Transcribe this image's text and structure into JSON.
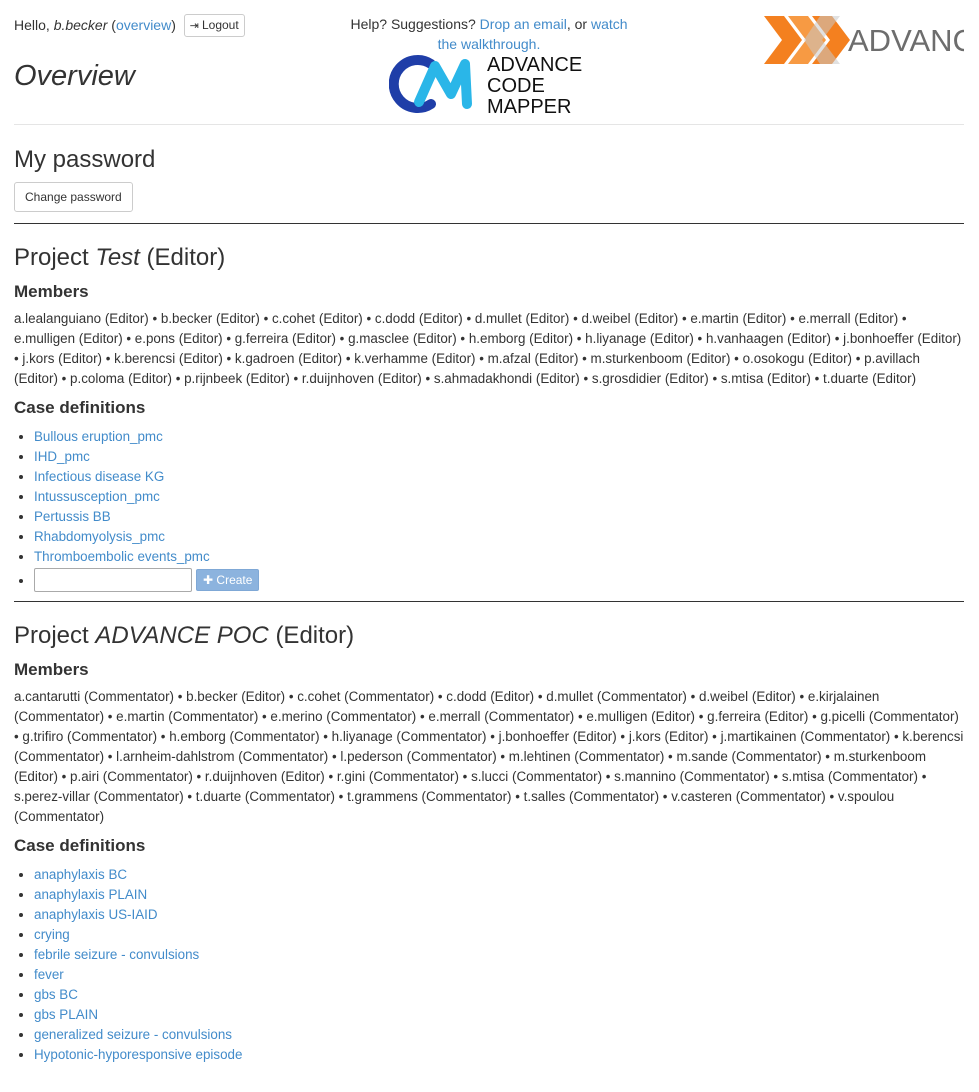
{
  "header": {
    "greeting": "Hello,",
    "username": "b.becker",
    "overview_link": "overview",
    "logout_label": "Logout",
    "page_title": "Overview",
    "help_prefix": "Help? Suggestions?",
    "help_email_link": "Drop an email",
    "help_middle": ", or",
    "help_walkthrough_link": "watch the walkthrough.",
    "cm_logo_text": [
      "ADVANCE",
      "CODE",
      "MAPPER"
    ],
    "advance_logo_text": "ADVANCE",
    "brand_colors": {
      "orange": "#f4801f",
      "blue": "#1f3ea8",
      "cyan": "#2ab6e8"
    }
  },
  "password": {
    "heading": "My password",
    "change_label": "Change password"
  },
  "projects": [
    {
      "heading_prefix": "Project",
      "name": "Test",
      "role": "(Editor)",
      "members_heading": "Members",
      "members_text": "a.lealanguiano (Editor) • b.becker (Editor) • c.cohet (Editor) • c.dodd (Editor) • d.mullet (Editor) • d.weibel (Editor) • e.martin (Editor) • e.merrall (Editor) • e.mulligen (Editor) • e.pons (Editor) • g.ferreira (Editor) • g.masclee (Editor) • h.emborg (Editor) • h.liyanage (Editor) • h.vanhaagen (Editor) • j.bonhoeffer (Editor) • j.kors (Editor) • k.berencsi (Editor) • k.gadroen (Editor) • k.verhamme (Editor) • m.afzal (Editor) • m.sturkenboom (Editor) • o.osokogu (Editor) • p.avillach (Editor) • p.coloma (Editor) • p.rijnbeek (Editor) • r.duijnhoven (Editor) • s.ahmadakhondi (Editor) • s.grosdidier (Editor) • s.mtisa (Editor) • t.duarte (Editor)",
      "cases_heading": "Case definitions",
      "cases": [
        "Bullous eruption_pmc",
        "IHD_pmc",
        "Infectious disease KG",
        "Intussusception_pmc",
        "Pertussis BB",
        "Rhabdomyolysis_pmc",
        "Thromboembolic events_pmc"
      ],
      "create_label": "Create"
    },
    {
      "heading_prefix": "Project",
      "name": "ADVANCE POC",
      "role": "(Editor)",
      "members_heading": "Members",
      "members_text": "a.cantarutti (Commentator) • b.becker (Editor) • c.cohet (Commentator) • c.dodd (Editor) • d.mullet (Commentator) • d.weibel (Editor) • e.kirjalainen (Commentator) • e.martin (Commentator) • e.merino (Commentator) • e.merrall (Commentator) • e.mulligen (Editor) • g.ferreira (Editor) • g.picelli (Commentator) • g.trifiro (Commentator) • h.emborg (Commentator) • h.liyanage (Commentator) • j.bonhoeffer (Editor) • j.kors (Editor) • j.martikainen (Commentator) • k.berencsi (Commentator) • l.arnheim-dahlstrom (Commentator) • l.pederson (Commentator) • m.lehtinen (Commentator) • m.sande (Commentator) • m.sturkenboom (Editor) • p.airi (Commentator) • r.duijnhoven (Editor) • r.gini (Commentator) • s.lucci (Commentator) • s.mannino (Commentator) • s.mtisa (Commentator) • s.perez-villar (Commentator) • t.duarte (Commentator) • t.grammens (Commentator) • t.salles (Commentator) • v.casteren (Commentator) • v.spoulou (Commentator)",
      "cases_heading": "Case definitions",
      "cases": [
        "anaphylaxis BC",
        "anaphylaxis PLAIN",
        "anaphylaxis US-IAID",
        "crying",
        "febrile seizure - convulsions",
        "fever",
        "gbs BC",
        "gbs PLAIN",
        "generalized seizure - convulsions",
        "Hypotonic-hyporesponsive episode"
      ]
    }
  ]
}
